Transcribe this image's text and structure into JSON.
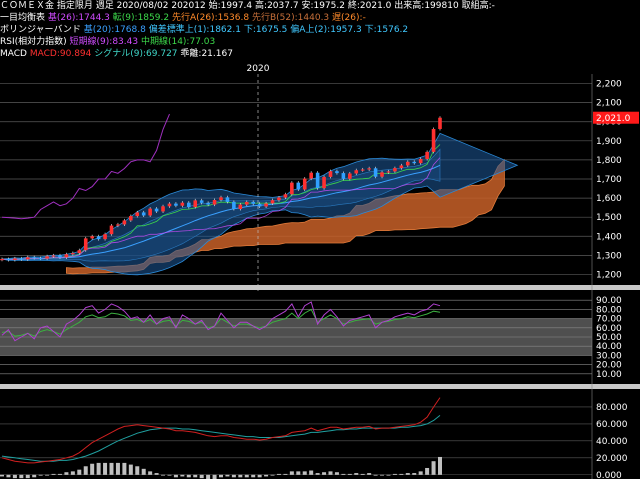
{
  "header": {
    "line1": {
      "instrument": "ＣＯＭＥＸ金 指定限月 週足",
      "date": "2020/08/02",
      "contract": "202012",
      "open_label": "始:",
      "open": "1997.4",
      "high_label": "高:",
      "high": "2037.7",
      "low_label": "安:",
      "low": "1975.2",
      "close_label": "終:",
      "close": "2021.0",
      "volume_label": "出来高:",
      "volume": "199810",
      "oi_label": "取組高:",
      "oi": "-"
    },
    "line2": {
      "name": "一目均衡表",
      "base_label": "基(26):",
      "base": "1744.3",
      "conv_label": "転(9):",
      "conv": "1859.2",
      "spanA_label": "先行A(26):",
      "spanA": "1536.8",
      "spanB_label": "先行B(52):",
      "spanB": "1440.3",
      "lag_label": "遅(26):",
      "lag": "-"
    },
    "line3": {
      "name": "ボリンジャーバンド",
      "mid_label": "基(20):",
      "mid": "1768.8",
      "up1_label": "偏差標準上(1):",
      "up1": "1862.1",
      "dn1_label": "下:",
      "dn1": "1675.5",
      "up2_label": "偏A上(2):",
      "up2": "1957.3",
      "dn2_label": "下:",
      "dn2": "1576.2"
    },
    "line4": {
      "name": "RSI(相対力指数)",
      "short_label": "短期線(9):",
      "short": "83.43",
      "mid_label": "中期線(14):",
      "mid": "77.03"
    },
    "line5": {
      "name": "MACD",
      "macd_label": "MACD:",
      "macd": "90.894",
      "signal_label": "シグナル(9):",
      "signal": "69.727",
      "hist_label": "乖離:",
      "hist": "21.167"
    }
  },
  "colors": {
    "up": "#ff3030",
    "down": "#30a0ff",
    "cloud_up": "#c86028",
    "band": "#1e5a9a",
    "rsi_short": "#b040d0",
    "rsi_mid": "#3cb040",
    "macd": "#d02020",
    "signal": "#20a0a0",
    "hist": "#c0c0c0"
  },
  "chart_data": [
    {
      "type": "candlestick",
      "panel": "price",
      "x_tick_label": "2020",
      "ylim": [
        1150,
        2250
      ],
      "yticks": [
        "1,200",
        "1,300",
        "1,400",
        "1,500",
        "1,600",
        "1,700",
        "1,800",
        "1,900",
        "2,000",
        "2,100",
        "2,200"
      ],
      "ytick_values": [
        1200,
        1300,
        1400,
        1500,
        1600,
        1700,
        1800,
        1900,
        2000,
        2100,
        2200
      ],
      "last_price_label": "2,021.0",
      "last_price": 2021,
      "candles": [
        1281,
        1276,
        1284,
        1279,
        1290,
        1286,
        1283,
        1295,
        1300,
        1289,
        1306,
        1312,
        1327,
        1389,
        1400,
        1385,
        1411,
        1456,
        1462,
        1483,
        1506,
        1525,
        1509,
        1545,
        1530,
        1557,
        1571,
        1560,
        1576,
        1553,
        1588,
        1575,
        1566,
        1590,
        1604,
        1580,
        1543,
        1566,
        1580,
        1570,
        1556,
        1572,
        1589,
        1603,
        1620,
        1681,
        1645,
        1702,
        1733,
        1652,
        1711,
        1741,
        1731,
        1701,
        1729,
        1746,
        1750,
        1756,
        1712,
        1735,
        1740,
        1757,
        1771,
        1790,
        1783,
        1805,
        1842,
        1962,
        2021
      ],
      "lagging_span": [
        1500,
        1498,
        1495,
        1492,
        1495,
        1500,
        1540,
        1560,
        1580,
        1560,
        1570,
        1600,
        1650,
        1640,
        1660,
        1700,
        1700,
        1740,
        1730,
        1755,
        1790,
        1800,
        1800,
        1790,
        1850,
        1960,
        2040
      ]
    },
    {
      "type": "line",
      "panel": "rsi",
      "ylim": [
        0,
        100
      ],
      "yticks": [
        "10.00",
        "20.00",
        "30.00",
        "40.00",
        "50.00",
        "60.00",
        "70.00",
        "80.00",
        "90.00"
      ],
      "ytick_values": [
        10,
        20,
        30,
        40,
        50,
        60,
        70,
        80,
        90
      ],
      "series": [
        {
          "name": "短期線(9)",
          "values": [
            52,
            58,
            46,
            50,
            54,
            48,
            60,
            62,
            56,
            50,
            64,
            68,
            74,
            82,
            84,
            76,
            80,
            86,
            83,
            78,
            70,
            72,
            66,
            74,
            64,
            70,
            72,
            60,
            74,
            70,
            64,
            68,
            58,
            62,
            76,
            68,
            60,
            66,
            66,
            62,
            58,
            62,
            70,
            74,
            78,
            86,
            72,
            84,
            88,
            64,
            74,
            80,
            72,
            62,
            68,
            70,
            72,
            74,
            60,
            66,
            68,
            72,
            74,
            76,
            74,
            78,
            80,
            86,
            84
          ]
        },
        {
          "name": "中期線(14)",
          "values": [
            55,
            56,
            51,
            52,
            54,
            51,
            56,
            58,
            56,
            53,
            58,
            62,
            66,
            72,
            74,
            71,
            72,
            76,
            75,
            73,
            68,
            69,
            66,
            69,
            64,
            67,
            68,
            62,
            68,
            67,
            64,
            66,
            60,
            62,
            70,
            66,
            62,
            64,
            64,
            62,
            60,
            62,
            66,
            68,
            70,
            76,
            70,
            76,
            80,
            66,
            70,
            74,
            70,
            64,
            66,
            68,
            69,
            70,
            64,
            66,
            67,
            69,
            70,
            72,
            71,
            73,
            75,
            78,
            77
          ]
        }
      ]
    },
    {
      "type": "bar+line",
      "panel": "macd",
      "ylim": [
        -5,
        100
      ],
      "yticks": [
        "0.000",
        "20.000",
        "40.000",
        "60.000",
        "80.000"
      ],
      "ytick_values": [
        0,
        20,
        40,
        60,
        80
      ],
      "series": [
        {
          "name": "MACD",
          "values": [
            20,
            18,
            16,
            15,
            14,
            14,
            15,
            16,
            17,
            18,
            20,
            22,
            26,
            32,
            38,
            42,
            46,
            50,
            54,
            57,
            58,
            59,
            58,
            57,
            56,
            55,
            54,
            52,
            52,
            51,
            50,
            48,
            46,
            45,
            46,
            46,
            44,
            43,
            42,
            42,
            41,
            42,
            44,
            45,
            46,
            50,
            51,
            52,
            55,
            52,
            54,
            56,
            56,
            54,
            55,
            56,
            56,
            57,
            54,
            55,
            55,
            56,
            57,
            58,
            59,
            62,
            68,
            80,
            91
          ]
        },
        {
          "name": "シグナル(9)",
          "values": [
            22,
            21,
            20,
            19,
            18,
            17,
            16,
            16,
            16,
            17,
            17,
            18,
            20,
            22,
            25,
            28,
            32,
            36,
            40,
            43,
            46,
            49,
            51,
            53,
            54,
            55,
            55,
            55,
            54,
            54,
            53,
            52,
            51,
            50,
            49,
            48,
            47,
            46,
            45,
            45,
            44,
            44,
            44,
            44,
            45,
            46,
            47,
            48,
            50,
            50,
            51,
            52,
            53,
            53,
            54,
            54,
            55,
            55,
            55,
            55,
            55,
            55,
            56,
            56,
            57,
            58,
            60,
            64,
            70
          ]
        },
        {
          "name": "乖離",
          "values": [
            -2,
            -3,
            -4,
            -4,
            -4,
            -3,
            -1,
            0,
            1,
            1,
            3,
            4,
            6,
            10,
            13,
            14,
            14,
            14,
            14,
            14,
            12,
            10,
            7,
            4,
            2,
            0,
            -1,
            -3,
            -2,
            -3,
            -3,
            -4,
            -5,
            -5,
            -3,
            -2,
            -3,
            -3,
            -3,
            -3,
            -3,
            -2,
            0,
            1,
            1,
            4,
            4,
            4,
            5,
            2,
            3,
            4,
            3,
            1,
            1,
            2,
            1,
            2,
            -1,
            0,
            0,
            1,
            1,
            2,
            2,
            4,
            8,
            16,
            21
          ]
        }
      ]
    }
  ]
}
